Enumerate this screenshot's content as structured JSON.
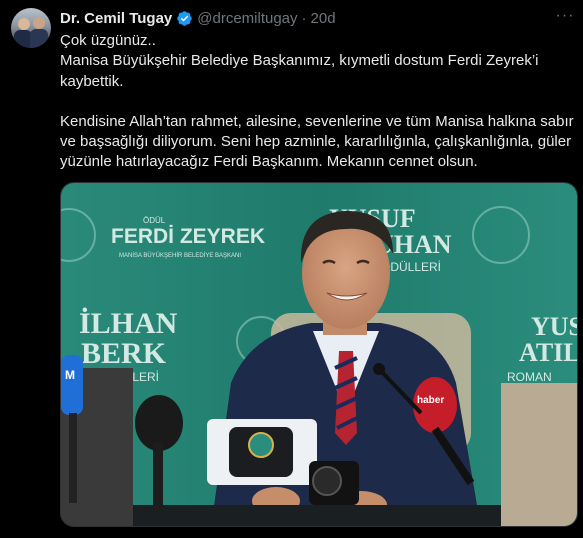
{
  "author": {
    "name": "Dr. Cemil Tugay",
    "handle": "@drcemiltugay",
    "separator": "·",
    "time": "20d",
    "avatar_icon": "profile-photo",
    "verified_icon": "verified-badge-icon",
    "more_icon": "more-icon"
  },
  "tweet": {
    "line1": "Çok üzgünüz..",
    "line2": "Manisa Büyükşehir Belediye Başkanımız, kıymetli dostum Ferdi Zeyrek’i kaybettik.",
    "line3": "Kendisine Allah’tan rahmet, ailesine, sevenlerine ve tüm Manisa halkına sabır ve başsağlığı diliyorum. Seni hep azminle, kararlılığınla, çalışkanlığınla, güler yüzünle hatırlayacağız Ferdi Başkanım. Mekanın cennet olsun."
  },
  "media": {
    "backdrop_title": "FERDİ ZEYREK",
    "backdrop_sub": "MANİSA BÜYÜKŞEHİR BELEDİYE BAŞKANI",
    "backdrop_name1": "YUSUF",
    "backdrop_name1b": "UHAN",
    "backdrop_odulleri": "ÖDÜLLERİ",
    "backdrop_ilhan": "İLHAN",
    "backdrop_berk": "BERK",
    "backdrop_odulleri2": "ÖDÜLLERİ",
    "backdrop_yus": "YUS",
    "backdrop_atil": "ATIL",
    "backdrop_roman": "ROMAN",
    "backdrop_pre": "ÖDÜL",
    "mic_left_label": "M",
    "mic_right_label": "haber",
    "colors": {
      "backdrop": "#1e7a6a",
      "accent_red": "#d2202f",
      "suit": "#1d2a4a"
    }
  }
}
